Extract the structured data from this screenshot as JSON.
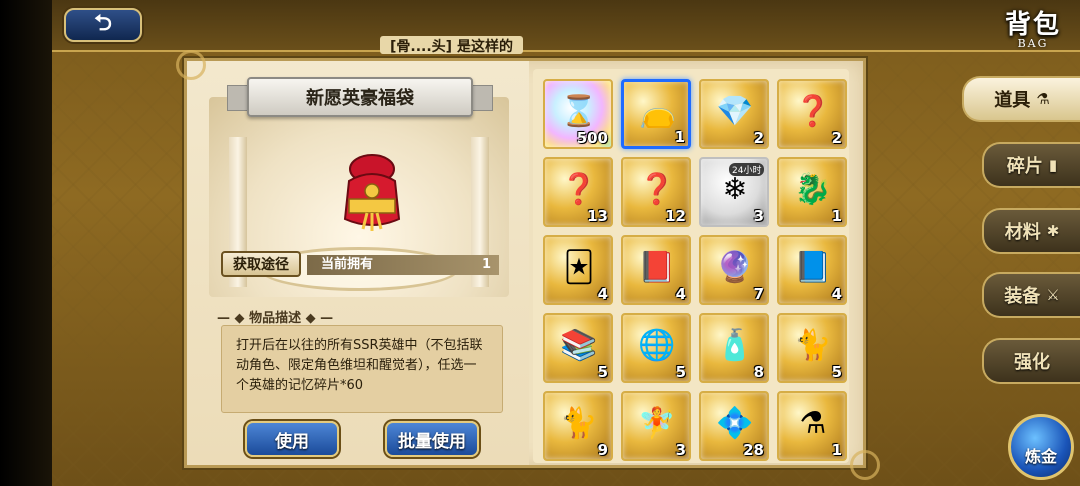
{
  "header": {
    "back_icon": "⮌",
    "subtitle": "[骨....头] 是这样的",
    "title_zh": "背包",
    "title_en": "BAG"
  },
  "detail": {
    "item_name": "新愿英豪福袋",
    "source_button": "获取途径",
    "owned_label": "当前拥有",
    "owned_count": "1",
    "desc_heading": "物品描述",
    "description": "打开后在以往的所有SSR英雄中（不包括联动角色、限定角色维坦和醒觉者），任选一个英雄的记忆碎片*60",
    "use_button": "使用",
    "bulk_use_button": "批量使用"
  },
  "grid": {
    "items": [
      {
        "icon": "hourglass-icon",
        "glyph": "⌛",
        "count": "500",
        "style": "rainbow"
      },
      {
        "icon": "lucky-bag-icon",
        "glyph": "👝",
        "count": "1",
        "style": "gold",
        "selected": true
      },
      {
        "icon": "chest-icon",
        "glyph": "💎",
        "count": "2",
        "style": "gold"
      },
      {
        "icon": "mystery-bag-icon",
        "glyph": "❓",
        "count": "2",
        "style": "gold"
      },
      {
        "icon": "mystery-scroll-icon",
        "glyph": "❓",
        "count": "13",
        "style": "gold"
      },
      {
        "icon": "mystery-scroll-icon",
        "glyph": "❓",
        "count": "12",
        "style": "gold"
      },
      {
        "icon": "snowflake-icon",
        "glyph": "❄",
        "count": "3",
        "style": "silver",
        "timer": "24小时"
      },
      {
        "icon": "dragon-card-icon",
        "glyph": "🐉",
        "count": "1",
        "style": "gold"
      },
      {
        "icon": "purple-card-icon",
        "glyph": "🃏",
        "count": "4",
        "style": "gold"
      },
      {
        "icon": "book-icon",
        "glyph": "📕",
        "count": "4",
        "style": "gold"
      },
      {
        "icon": "crystal-ball-icon",
        "glyph": "🔮",
        "count": "7",
        "style": "gold"
      },
      {
        "icon": "picture-book-icon",
        "glyph": "📘",
        "count": "4",
        "style": "gold"
      },
      {
        "icon": "comic-icon",
        "glyph": "📚",
        "count": "5",
        "style": "gold"
      },
      {
        "icon": "globe-icon",
        "glyph": "🌐",
        "count": "5",
        "style": "gold"
      },
      {
        "icon": "tube-icon",
        "glyph": "🧴",
        "count": "8",
        "style": "gold"
      },
      {
        "icon": "white-cat-icon",
        "glyph": "🐈",
        "count": "5",
        "style": "gold"
      },
      {
        "icon": "black-cat-icon",
        "glyph": "🐈",
        "count": "9",
        "style": "gold"
      },
      {
        "icon": "figure-icon",
        "glyph": "🧚",
        "count": "3",
        "style": "gold"
      },
      {
        "icon": "blue-gem-icon",
        "glyph": "💠",
        "count": "28",
        "style": "gold"
      },
      {
        "icon": "potion-icon",
        "glyph": "⚗",
        "count": "1",
        "style": "gold"
      }
    ]
  },
  "tabs": [
    {
      "label": "道具",
      "icon": "flask-icon",
      "glyph": "⚗",
      "active": true
    },
    {
      "label": "碎片",
      "icon": "shard-icon",
      "glyph": "▮",
      "active": false
    },
    {
      "label": "材料",
      "icon": "gear-icon",
      "glyph": "✱",
      "active": false
    },
    {
      "label": "装备",
      "icon": "equipment-icon",
      "glyph": "⚔",
      "active": false
    },
    {
      "label": "强化",
      "icon": "enhance-icon",
      "glyph": "",
      "active": false
    }
  ],
  "alchemy_button": "炼金"
}
